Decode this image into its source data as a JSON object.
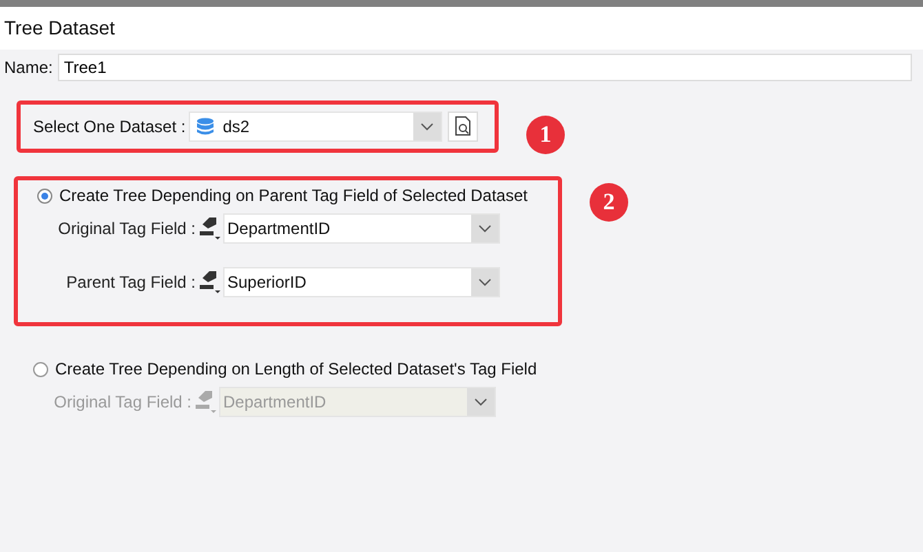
{
  "window": {
    "title": "Tree Dataset"
  },
  "name_field": {
    "label": "Name:",
    "value": "Tree1"
  },
  "dataset": {
    "label": "Select One Dataset :",
    "value": "ds2",
    "annotation": "1"
  },
  "options": [
    {
      "label": "Create Tree Depending on Parent Tag Field of Selected Dataset",
      "selected": true,
      "annotation": "2",
      "fields": [
        {
          "label": "Original Tag Field :",
          "value": "DepartmentID",
          "disabled": false
        },
        {
          "label": "Parent Tag Field :",
          "value": "SuperiorID",
          "disabled": false
        }
      ]
    },
    {
      "label": "Create Tree Depending on Length of Selected Dataset's Tag Field",
      "selected": false,
      "fields": [
        {
          "label": "Original Tag Field :",
          "value": "DepartmentID",
          "disabled": true
        }
      ]
    }
  ]
}
